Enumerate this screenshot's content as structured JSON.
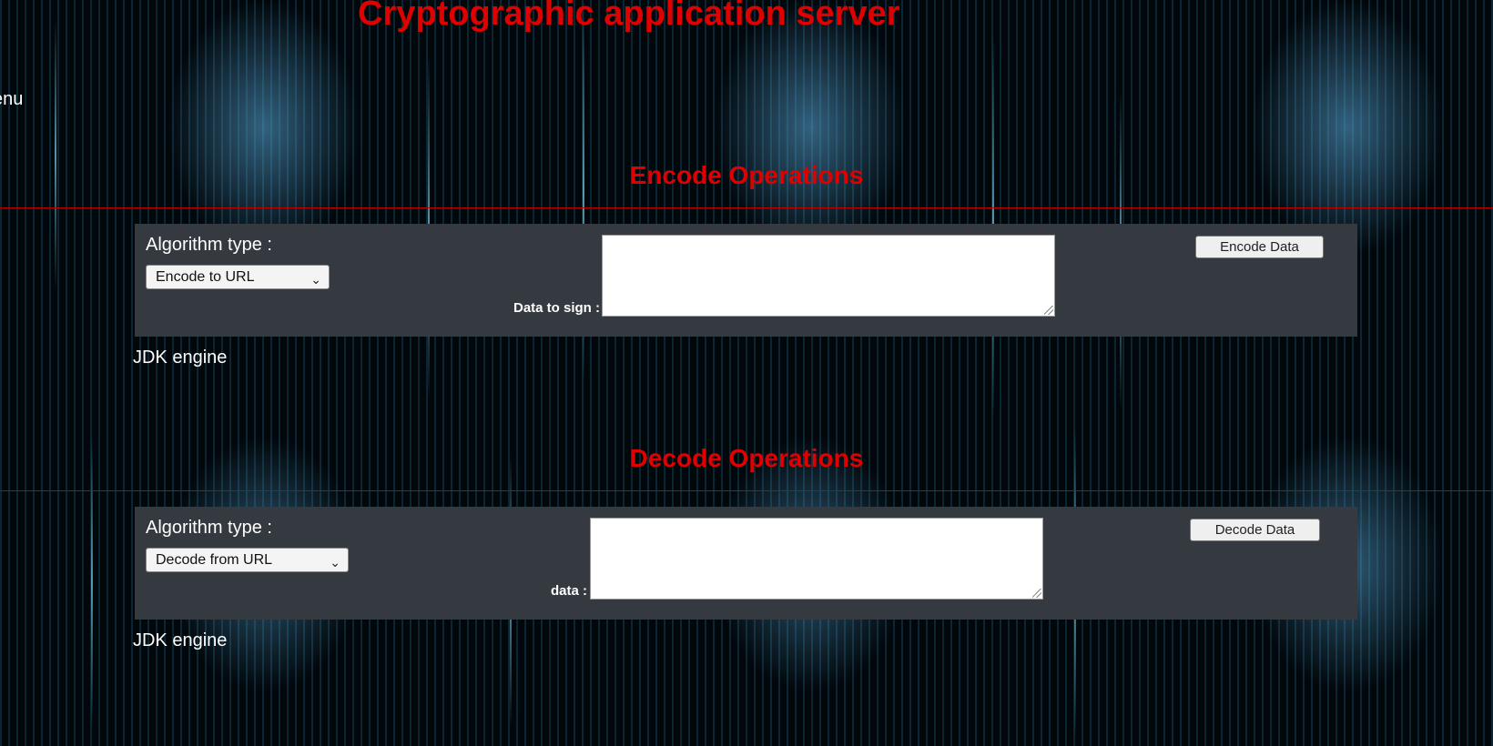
{
  "header": {
    "title": "Cryptographic application server",
    "menu_label": "enu"
  },
  "encode": {
    "section_title": "Encode Operations",
    "algorithm_label": "Algorithm type :",
    "algorithm_selected": "Encode to URL",
    "field_label": "Data to sign :",
    "field_value": "",
    "button_label": "Encode Data",
    "engine_label": "JDK engine"
  },
  "decode": {
    "section_title": "Decode Operations",
    "algorithm_label": "Algorithm type :",
    "algorithm_selected": "Decode from URL",
    "field_label": "data :",
    "field_value": "",
    "button_label": "Decode Data",
    "engine_label": "JDK engine"
  },
  "colors": {
    "accent": "#e00000",
    "panel": "#343a40",
    "background": "#02070b"
  },
  "icons": {
    "select_arrow": "chevron-down-icon",
    "textarea_resize": "resize-grip-icon"
  }
}
